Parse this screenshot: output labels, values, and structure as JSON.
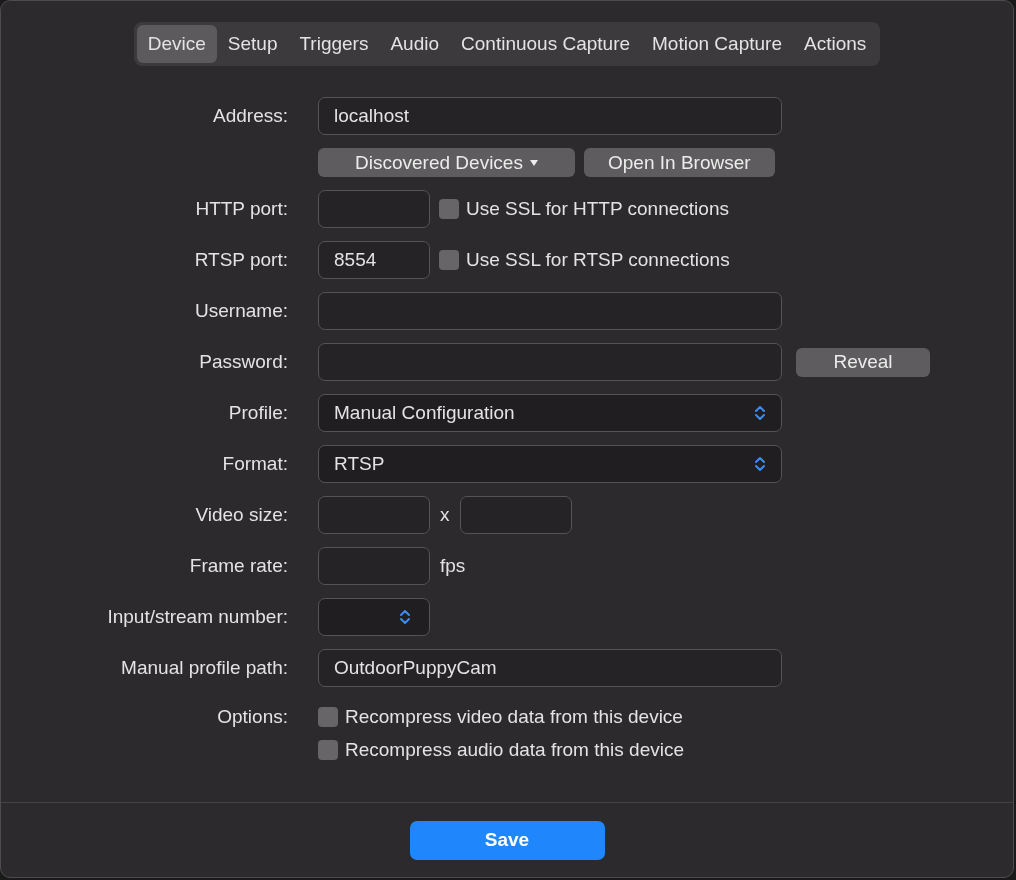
{
  "tabs": [
    {
      "label": "Device",
      "selected": true
    },
    {
      "label": "Setup",
      "selected": false
    },
    {
      "label": "Triggers",
      "selected": false
    },
    {
      "label": "Audio",
      "selected": false
    },
    {
      "label": "Continuous Capture",
      "selected": false
    },
    {
      "label": "Motion Capture",
      "selected": false
    },
    {
      "label": "Actions",
      "selected": false
    }
  ],
  "form": [
    {
      "kind": "text",
      "label": "Address:",
      "value": "localhost"
    },
    {
      "kind": "buttons",
      "buttons": [
        {
          "label": "Discovered Devices",
          "menu": true
        },
        {
          "label": "Open In Browser",
          "menu": false
        }
      ]
    },
    {
      "kind": "port",
      "label": "HTTP port:",
      "checkbox": {
        "label": "Use SSL for HTTP connections",
        "checked": false
      }
    },
    {
      "kind": "port",
      "label": "RTSP port:",
      "value": "8554",
      "checkbox": {
        "label": "Use SSL for RTSP connections",
        "checked": false
      }
    },
    {
      "kind": "text",
      "label": "Username:"
    },
    {
      "kind": "password",
      "label": "Password:",
      "button": "Reveal"
    },
    {
      "kind": "popup",
      "label": "Profile:",
      "value": "Manual Configuration"
    },
    {
      "kind": "popup",
      "label": "Format:",
      "value": "RTSP"
    },
    {
      "kind": "size",
      "label": "Video size:",
      "separator": "x"
    },
    {
      "kind": "unit",
      "label": "Frame rate:",
      "unit": "fps"
    },
    {
      "kind": "stepper",
      "label": "Input/stream number:"
    },
    {
      "kind": "text",
      "label": "Manual profile path:",
      "value": "OutdoorPuppyCam"
    },
    {
      "kind": "checks",
      "label": "Options:",
      "checks": [
        {
          "label": "Recompress video data from this device",
          "checked": false
        },
        {
          "label": "Recompress audio data from this device",
          "checked": false
        }
      ]
    }
  ],
  "save_button": "Save"
}
